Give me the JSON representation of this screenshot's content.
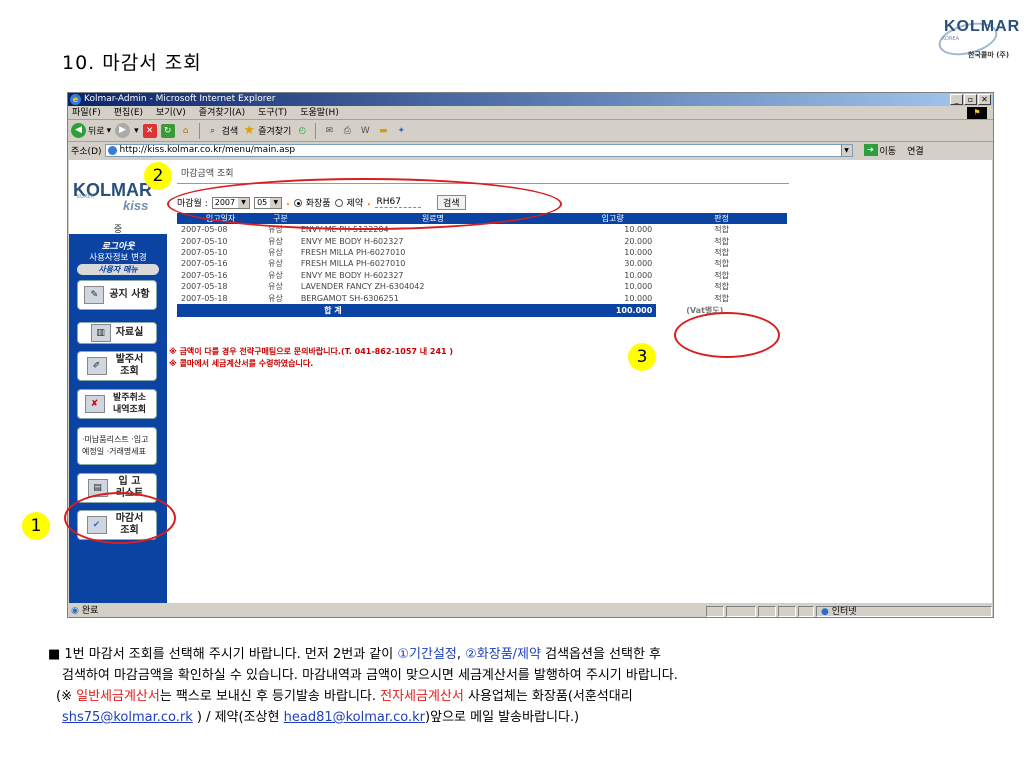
{
  "slide": {
    "title": "10. 마감서 조회"
  },
  "logo": {
    "brand": "KOLMAR",
    "sub": "KOREA",
    "kor": "한국콜마 (주)"
  },
  "window": {
    "title": "Kolmar-Admin - Microsoft Internet Explorer",
    "buttons": [
      "_",
      "▫",
      "✕"
    ],
    "menu": [
      "파일(F)",
      "편집(E)",
      "보기(V)",
      "즐겨찾기(A)",
      "도구(T)",
      "도움말(H)"
    ],
    "toolbar": {
      "back": "뒤로",
      "search": "검색",
      "favorites": "즐겨찾기"
    },
    "address_label": "주소(D)",
    "address": "http://kiss.kolmar.co.kr/menu/main.asp",
    "go_label": "이동",
    "links_label": "연결",
    "status_left": "완료",
    "status_zone": "인터넷"
  },
  "sidebar": {
    "logo": "KOLMAR",
    "logo_sub": "KOREA",
    "logo_kiss": "kiss",
    "user": "중",
    "logout": "로그아웃",
    "profile": "사용자정보 변경",
    "manual": "사용자 매뉴",
    "items": [
      {
        "label": "공지 사항",
        "icon": "notice-icon"
      },
      {
        "label": "자료실",
        "icon": "archive-icon"
      },
      {
        "label": "발주서 조회",
        "icon": "order-icon"
      },
      {
        "label": "발주취소 내역조회",
        "icon": "cancel-icon"
      },
      {
        "label": "·미납품리스트 ·입고 예정일 ·거래명세표",
        "icon": "list-icon"
      },
      {
        "label": "입 고 리스트",
        "icon": "receiving-icon"
      },
      {
        "label": "마감서 조회",
        "icon": "closing-icon"
      }
    ]
  },
  "panel": {
    "title": "마감금액 조회",
    "search": {
      "month_label": "마감월 :",
      "year": "2007",
      "month": "05",
      "opt_cosmetic": "화장품",
      "opt_pharma": "제약",
      "code": "RH67",
      "button": "검색"
    },
    "columns": [
      "입고일자",
      "구분",
      "원료명",
      "입고량",
      "판정"
    ],
    "rows": [
      {
        "date": "2007-05-08",
        "type": "유상",
        "name": "ENVY ME PH-5122284",
        "qty": "10.000",
        "result": "적합"
      },
      {
        "date": "2007-05-10",
        "type": "유상",
        "name": "ENVY ME BODY H-602327",
        "qty": "20.000",
        "result": "적합"
      },
      {
        "date": "2007-05-10",
        "type": "유상",
        "name": "FRESH MILLA PH-6027010",
        "qty": "10.000",
        "result": "적합"
      },
      {
        "date": "2007-05-16",
        "type": "유상",
        "name": "FRESH MILLA PH-6027010",
        "qty": "30.000",
        "result": "적합"
      },
      {
        "date": "2007-05-16",
        "type": "유상",
        "name": "ENVY ME BODY H-602327",
        "qty": "10.000",
        "result": "적합"
      },
      {
        "date": "2007-05-18",
        "type": "유상",
        "name": "LAVENDER FANCY ZH-6304042",
        "qty": "10.000",
        "result": "적합"
      },
      {
        "date": "2007-05-18",
        "type": "유상",
        "name": "BERGAMOT SH-6306251",
        "qty": "10.000",
        "result": "적합"
      }
    ],
    "total_label": "합 계",
    "total_qty": "100.000",
    "total_vat": "(Vat별도)",
    "note1": "※ 금액이 다를 경우 전략구매팀으로 문의바랍니다.(T. 041-862-1057 내 241 )",
    "note2": "※ 콜마에서 세금계산서를 수령하였습니다."
  },
  "annotations": {
    "n1": "1",
    "n2": "2",
    "n3": "3"
  },
  "caption": {
    "l1_a": "■ 1번 마감서 조회를 선택해 주시기 바랍니다. 먼저 2번과 같이 ",
    "l1_b": "①기간설정",
    "l1_c": ", ",
    "l1_d": "②화장품/제약",
    "l1_e": " 검색옵션을 선택한 후",
    "l2": "검색하여 마감금액을 확인하실 수 있습니다. 마감내역과 금액이 맞으시면 세금계산서를 발행하여 주시기 바랍니다.",
    "l3_a": "(※ ",
    "l3_b": "일반세금계산서",
    "l3_c": "는 팩스로 보내신 후 등기발송 바랍니다. ",
    "l3_d": "전자세금계산서",
    "l3_e": " 사용업체는 화장품(서훈석대리",
    "l4_email1": "shs75@kolmar.co.rk",
    "l4_b": " ) / 제약(조상현 ",
    "l4_email2": "head81@kolmar.co.kr",
    "l4_c": ")앞으로 메일 발송바랍니다.)"
  }
}
